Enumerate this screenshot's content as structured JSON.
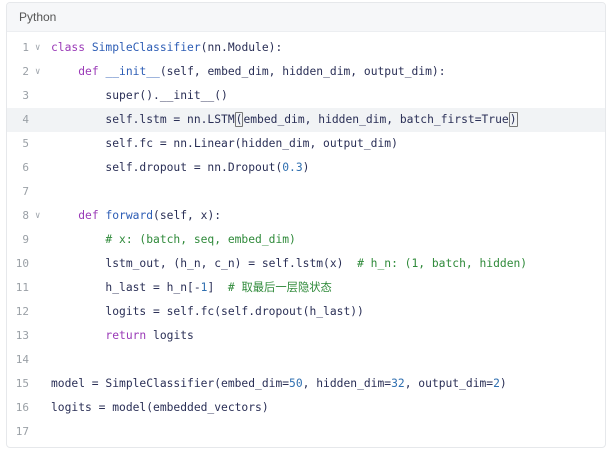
{
  "header": {
    "language": "Python"
  },
  "lines": [
    {
      "n": "1",
      "fold": true,
      "hl": false,
      "tokens": [
        {
          "t": "class ",
          "c": "kw"
        },
        {
          "t": "SimpleClassifier",
          "c": "fn"
        },
        {
          "t": "(nn.Module):",
          "c": ""
        }
      ]
    },
    {
      "n": "2",
      "fold": true,
      "hl": false,
      "tokens": [
        {
          "t": "    ",
          "c": ""
        },
        {
          "t": "def ",
          "c": "kw"
        },
        {
          "t": "__init__",
          "c": "fn"
        },
        {
          "t": "(self, embed_dim, hidden_dim, output_dim):",
          "c": ""
        }
      ]
    },
    {
      "n": "3",
      "fold": false,
      "hl": false,
      "tokens": [
        {
          "t": "        super().__init__()",
          "c": ""
        }
      ]
    },
    {
      "n": "4",
      "fold": false,
      "hl": true,
      "tokens": [
        {
          "t": "        self.lstm = nn.LSTM",
          "c": ""
        },
        {
          "t": "(",
          "c": "bk"
        },
        {
          "t": "embed_dim, hidden_dim, batch_first=True",
          "c": ""
        },
        {
          "t": ")",
          "c": "bk"
        }
      ]
    },
    {
      "n": "5",
      "fold": false,
      "hl": false,
      "tokens": [
        {
          "t": "        self.fc = nn.Linear(hidden_dim, output_dim)",
          "c": ""
        }
      ]
    },
    {
      "n": "6",
      "fold": false,
      "hl": false,
      "tokens": [
        {
          "t": "        self.dropout = nn.Dropout(",
          "c": ""
        },
        {
          "t": "0.3",
          "c": "nm"
        },
        {
          "t": ")",
          "c": ""
        }
      ]
    },
    {
      "n": "7",
      "fold": false,
      "hl": false,
      "tokens": []
    },
    {
      "n": "8",
      "fold": true,
      "hl": false,
      "tokens": [
        {
          "t": "    ",
          "c": ""
        },
        {
          "t": "def ",
          "c": "kw"
        },
        {
          "t": "forward",
          "c": "fn"
        },
        {
          "t": "(self, x):",
          "c": ""
        }
      ]
    },
    {
      "n": "9",
      "fold": false,
      "hl": false,
      "tokens": [
        {
          "t": "        # x: (batch, seq, embed_dim)",
          "c": "cm"
        }
      ]
    },
    {
      "n": "10",
      "fold": false,
      "hl": false,
      "tokens": [
        {
          "t": "        lstm_out, (h_n, c_n) = self.lstm(x)  ",
          "c": ""
        },
        {
          "t": "# h_n: (1, batch, hidden)",
          "c": "cm"
        }
      ]
    },
    {
      "n": "11",
      "fold": false,
      "hl": false,
      "tokens": [
        {
          "t": "        h_last = h_n[-",
          "c": ""
        },
        {
          "t": "1",
          "c": "nm"
        },
        {
          "t": "]  ",
          "c": ""
        },
        {
          "t": "# 取最后一层隐状态",
          "c": "cm"
        }
      ]
    },
    {
      "n": "12",
      "fold": false,
      "hl": false,
      "tokens": [
        {
          "t": "        logits = self.fc(self.dropout(h_last))",
          "c": ""
        }
      ]
    },
    {
      "n": "13",
      "fold": false,
      "hl": false,
      "tokens": [
        {
          "t": "        ",
          "c": ""
        },
        {
          "t": "return",
          "c": "kw"
        },
        {
          "t": " logits",
          "c": ""
        }
      ]
    },
    {
      "n": "14",
      "fold": false,
      "hl": false,
      "tokens": []
    },
    {
      "n": "15",
      "fold": false,
      "hl": false,
      "tokens": [
        {
          "t": "model = SimpleClassifier(embed_dim=",
          "c": ""
        },
        {
          "t": "50",
          "c": "nm"
        },
        {
          "t": ", hidden_dim=",
          "c": ""
        },
        {
          "t": "32",
          "c": "nm"
        },
        {
          "t": ", output_dim=",
          "c": ""
        },
        {
          "t": "2",
          "c": "nm"
        },
        {
          "t": ")",
          "c": ""
        }
      ]
    },
    {
      "n": "16",
      "fold": false,
      "hl": false,
      "tokens": [
        {
          "t": "logits = model(embedded_vectors)",
          "c": ""
        }
      ]
    },
    {
      "n": "17",
      "fold": false,
      "hl": false,
      "tokens": []
    }
  ]
}
